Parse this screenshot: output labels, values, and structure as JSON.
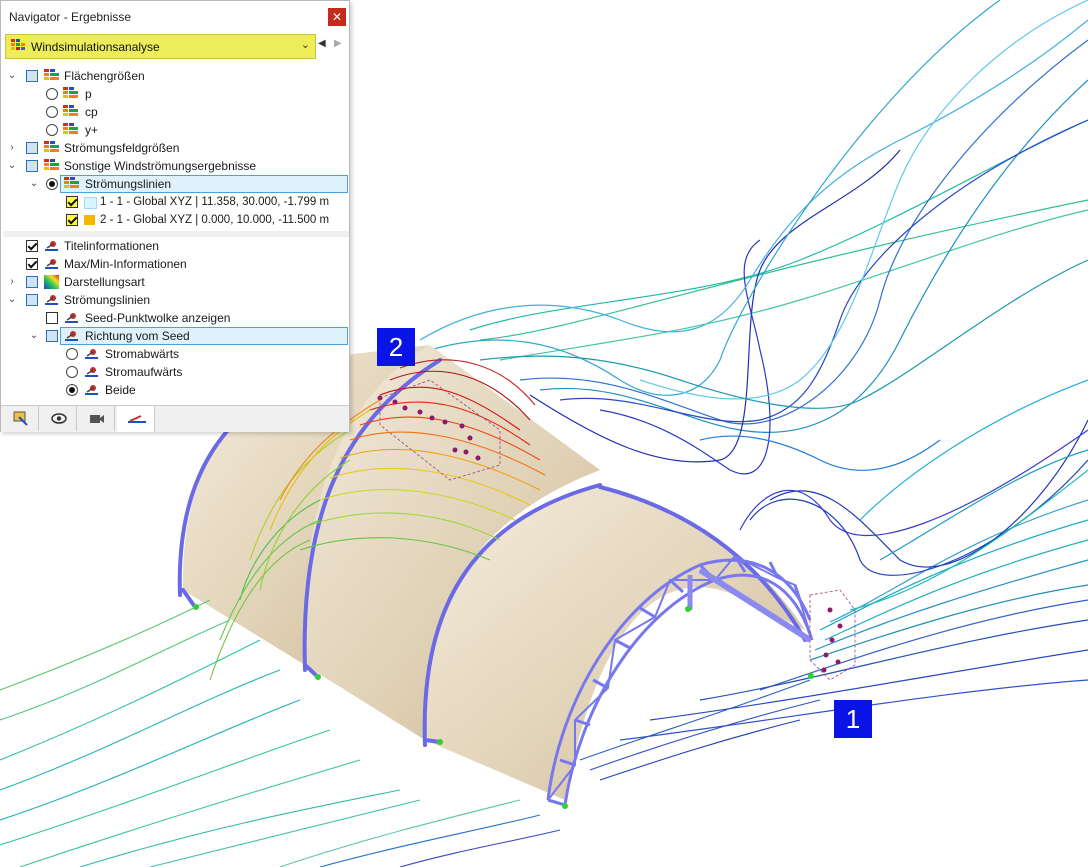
{
  "window": {
    "title": "Navigator - Ergebnisse"
  },
  "combo": {
    "value": "Windsimulationsanalyse"
  },
  "tree": {
    "flaechen": "Flächengrößen",
    "p": "p",
    "cp": "cp",
    "yplus": "y+",
    "stroemfeld": "Strömungsfeldgrößen",
    "sonstige": "Sonstige Windströmungsergebnisse",
    "linien": "Strömungslinien",
    "line1": "1 - 1 - Global XYZ | 11.358, 30.000, -1.799 m",
    "line2": "2 - 1 - Global XYZ | 0.000, 10.000, -11.500 m",
    "titel": "Titelinformationen",
    "maxmin": "Max/Min-Informationen",
    "darst": "Darstellungsart",
    "linien2": "Strömungslinien",
    "seedcloud": "Seed-Punktwolke anzeigen",
    "richtung": "Richtung vom Seed",
    "ab": "Stromabwärts",
    "auf": "Stromaufwärts",
    "beide": "Beide"
  },
  "badges": {
    "b1": "1",
    "b2": "2"
  },
  "colors": {
    "combo": "#eded5a",
    "badge": "#0a14e6",
    "truss": "#7070e6",
    "roof": "#e8dcc4",
    "line1_swatch": "#d8f4ff",
    "line2_swatch": "#f5b800"
  }
}
